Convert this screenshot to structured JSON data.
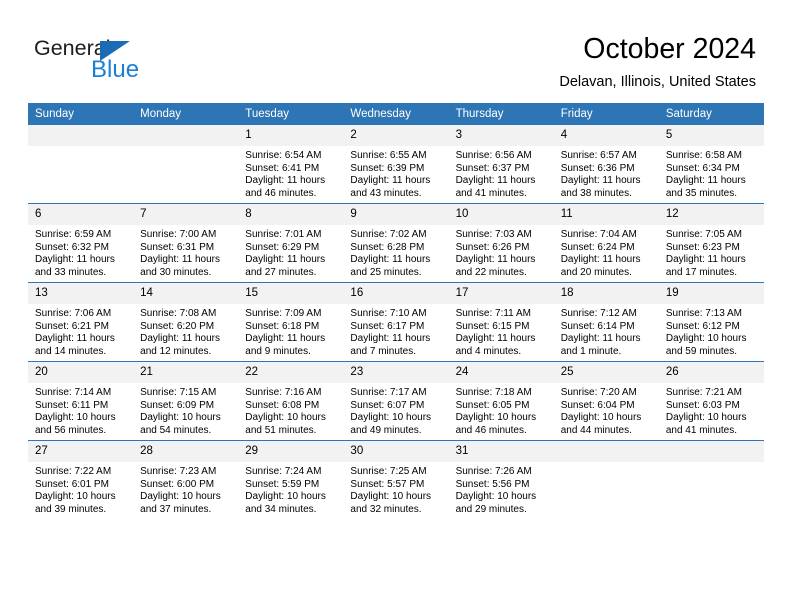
{
  "brand": {
    "name_part1": "General",
    "name_part2": "Blue",
    "triangle_color": "#1b6cb5",
    "blue_color": "#1b7fd4"
  },
  "header": {
    "title": "October 2024",
    "subtitle": "Delavan, Illinois, United States"
  },
  "theme": {
    "header_blue": "#2e75b6",
    "daynum_gray": "#f2f2f2",
    "text_black": "#000000"
  },
  "weekday_headers": [
    "Sunday",
    "Monday",
    "Tuesday",
    "Wednesday",
    "Thursday",
    "Friday",
    "Saturday"
  ],
  "labels": {
    "sunrise_prefix": "Sunrise: ",
    "sunset_prefix": "Sunset: ",
    "daylight_prefix": "Daylight: "
  },
  "weeks": [
    [
      {
        "empty": true
      },
      {
        "empty": true
      },
      {
        "day": "1",
        "sunrise": "Sunrise: 6:54 AM",
        "sunset": "Sunset: 6:41 PM",
        "daylight": "Daylight: 11 hours and 46 minutes."
      },
      {
        "day": "2",
        "sunrise": "Sunrise: 6:55 AM",
        "sunset": "Sunset: 6:39 PM",
        "daylight": "Daylight: 11 hours and 43 minutes."
      },
      {
        "day": "3",
        "sunrise": "Sunrise: 6:56 AM",
        "sunset": "Sunset: 6:37 PM",
        "daylight": "Daylight: 11 hours and 41 minutes."
      },
      {
        "day": "4",
        "sunrise": "Sunrise: 6:57 AM",
        "sunset": "Sunset: 6:36 PM",
        "daylight": "Daylight: 11 hours and 38 minutes."
      },
      {
        "day": "5",
        "sunrise": "Sunrise: 6:58 AM",
        "sunset": "Sunset: 6:34 PM",
        "daylight": "Daylight: 11 hours and 35 minutes."
      }
    ],
    [
      {
        "day": "6",
        "sunrise": "Sunrise: 6:59 AM",
        "sunset": "Sunset: 6:32 PM",
        "daylight": "Daylight: 11 hours and 33 minutes."
      },
      {
        "day": "7",
        "sunrise": "Sunrise: 7:00 AM",
        "sunset": "Sunset: 6:31 PM",
        "daylight": "Daylight: 11 hours and 30 minutes."
      },
      {
        "day": "8",
        "sunrise": "Sunrise: 7:01 AM",
        "sunset": "Sunset: 6:29 PM",
        "daylight": "Daylight: 11 hours and 27 minutes."
      },
      {
        "day": "9",
        "sunrise": "Sunrise: 7:02 AM",
        "sunset": "Sunset: 6:28 PM",
        "daylight": "Daylight: 11 hours and 25 minutes."
      },
      {
        "day": "10",
        "sunrise": "Sunrise: 7:03 AM",
        "sunset": "Sunset: 6:26 PM",
        "daylight": "Daylight: 11 hours and 22 minutes."
      },
      {
        "day": "11",
        "sunrise": "Sunrise: 7:04 AM",
        "sunset": "Sunset: 6:24 PM",
        "daylight": "Daylight: 11 hours and 20 minutes."
      },
      {
        "day": "12",
        "sunrise": "Sunrise: 7:05 AM",
        "sunset": "Sunset: 6:23 PM",
        "daylight": "Daylight: 11 hours and 17 minutes."
      }
    ],
    [
      {
        "day": "13",
        "sunrise": "Sunrise: 7:06 AM",
        "sunset": "Sunset: 6:21 PM",
        "daylight": "Daylight: 11 hours and 14 minutes."
      },
      {
        "day": "14",
        "sunrise": "Sunrise: 7:08 AM",
        "sunset": "Sunset: 6:20 PM",
        "daylight": "Daylight: 11 hours and 12 minutes."
      },
      {
        "day": "15",
        "sunrise": "Sunrise: 7:09 AM",
        "sunset": "Sunset: 6:18 PM",
        "daylight": "Daylight: 11 hours and 9 minutes."
      },
      {
        "day": "16",
        "sunrise": "Sunrise: 7:10 AM",
        "sunset": "Sunset: 6:17 PM",
        "daylight": "Daylight: 11 hours and 7 minutes."
      },
      {
        "day": "17",
        "sunrise": "Sunrise: 7:11 AM",
        "sunset": "Sunset: 6:15 PM",
        "daylight": "Daylight: 11 hours and 4 minutes."
      },
      {
        "day": "18",
        "sunrise": "Sunrise: 7:12 AM",
        "sunset": "Sunset: 6:14 PM",
        "daylight": "Daylight: 11 hours and 1 minute."
      },
      {
        "day": "19",
        "sunrise": "Sunrise: 7:13 AM",
        "sunset": "Sunset: 6:12 PM",
        "daylight": "Daylight: 10 hours and 59 minutes."
      }
    ],
    [
      {
        "day": "20",
        "sunrise": "Sunrise: 7:14 AM",
        "sunset": "Sunset: 6:11 PM",
        "daylight": "Daylight: 10 hours and 56 minutes."
      },
      {
        "day": "21",
        "sunrise": "Sunrise: 7:15 AM",
        "sunset": "Sunset: 6:09 PM",
        "daylight": "Daylight: 10 hours and 54 minutes."
      },
      {
        "day": "22",
        "sunrise": "Sunrise: 7:16 AM",
        "sunset": "Sunset: 6:08 PM",
        "daylight": "Daylight: 10 hours and 51 minutes."
      },
      {
        "day": "23",
        "sunrise": "Sunrise: 7:17 AM",
        "sunset": "Sunset: 6:07 PM",
        "daylight": "Daylight: 10 hours and 49 minutes."
      },
      {
        "day": "24",
        "sunrise": "Sunrise: 7:18 AM",
        "sunset": "Sunset: 6:05 PM",
        "daylight": "Daylight: 10 hours and 46 minutes."
      },
      {
        "day": "25",
        "sunrise": "Sunrise: 7:20 AM",
        "sunset": "Sunset: 6:04 PM",
        "daylight": "Daylight: 10 hours and 44 minutes."
      },
      {
        "day": "26",
        "sunrise": "Sunrise: 7:21 AM",
        "sunset": "Sunset: 6:03 PM",
        "daylight": "Daylight: 10 hours and 41 minutes."
      }
    ],
    [
      {
        "day": "27",
        "sunrise": "Sunrise: 7:22 AM",
        "sunset": "Sunset: 6:01 PM",
        "daylight": "Daylight: 10 hours and 39 minutes."
      },
      {
        "day": "28",
        "sunrise": "Sunrise: 7:23 AM",
        "sunset": "Sunset: 6:00 PM",
        "daylight": "Daylight: 10 hours and 37 minutes."
      },
      {
        "day": "29",
        "sunrise": "Sunrise: 7:24 AM",
        "sunset": "Sunset: 5:59 PM",
        "daylight": "Daylight: 10 hours and 34 minutes."
      },
      {
        "day": "30",
        "sunrise": "Sunrise: 7:25 AM",
        "sunset": "Sunset: 5:57 PM",
        "daylight": "Daylight: 10 hours and 32 minutes."
      },
      {
        "day": "31",
        "sunrise": "Sunrise: 7:26 AM",
        "sunset": "Sunset: 5:56 PM",
        "daylight": "Daylight: 10 hours and 29 minutes."
      },
      {
        "empty": true
      },
      {
        "empty": true
      }
    ]
  ]
}
